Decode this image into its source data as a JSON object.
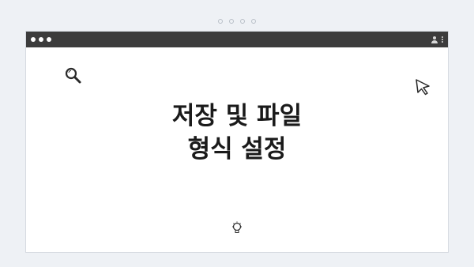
{
  "carousel": {
    "dots": [
      "dot-1",
      "dot-2",
      "dot-3",
      "dot-4"
    ]
  },
  "window": {
    "controls": [
      "close",
      "minimize",
      "maximize"
    ],
    "toolbar_icons": [
      "user-icon",
      "kebab-menu-icon"
    ]
  },
  "content": {
    "headline_line_1": "저장 및 파일",
    "headline_line_2": "형식 설정",
    "decor_icons": [
      "search-icon",
      "cursor-icon",
      "lightbulb-icon"
    ]
  },
  "colors": {
    "background": "#eef1f5",
    "titlebar": "#3c3c3c",
    "window": "#ffffff",
    "text": "#1a1a1a"
  }
}
